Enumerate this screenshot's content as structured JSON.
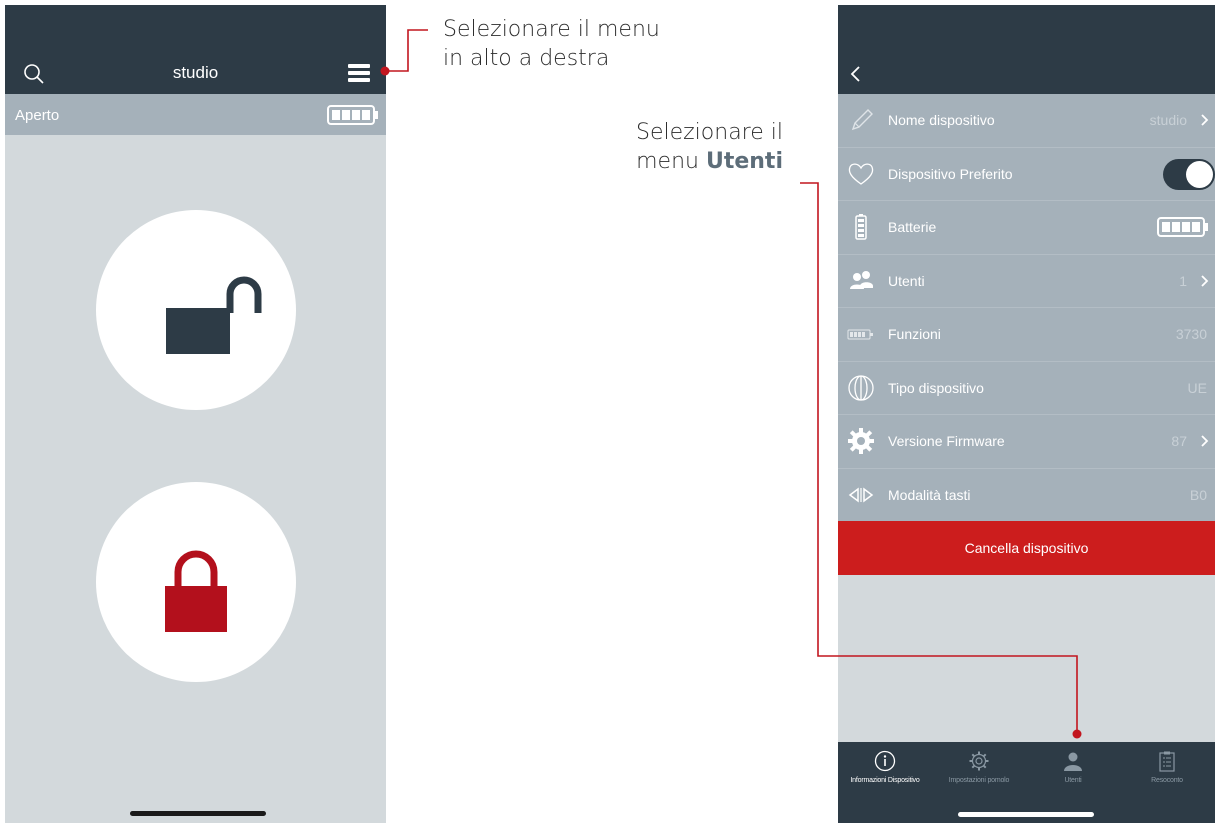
{
  "left_screen": {
    "title": "studio",
    "status_text": "Aperto",
    "icons": {
      "search": "search-icon",
      "menu": "hamburger-menu-icon",
      "battery": "battery-full-icon",
      "unlock": "padlock-open-icon",
      "lock": "padlock-closed-icon"
    },
    "colors": {
      "header": "#2d3b46",
      "status_bar": "#a5b1ba",
      "lock_red": "#b3101c"
    }
  },
  "annotations": {
    "menu_hint_line1": "Selezionare il menu",
    "menu_hint_line2": "in alto a destra",
    "users_hint_line1": "Selezionare il",
    "users_hint_prefix": "menu",
    "users_hint_bold": "Utenti"
  },
  "right_screen": {
    "rows": [
      {
        "label": "Nome dispositivo",
        "value": "studio",
        "icon": "pencil-icon"
      },
      {
        "label": "Dispositivo Preferito",
        "icon": "heart-icon",
        "toggle": "on"
      },
      {
        "label": "Batterie",
        "icon": "battery-vertical-icon"
      },
      {
        "label": "Utenti",
        "value": "1",
        "icon": "users-icon"
      },
      {
        "label": "Funzioni",
        "value": "3730",
        "icon": "counter-icon"
      },
      {
        "label": "Tipo dispositivo",
        "value": "UE",
        "icon": "knob-icon"
      },
      {
        "label": "Versione Firmware",
        "value": "87",
        "icon": "gear-icon"
      },
      {
        "label": "Modalità tasti",
        "value": "B0",
        "icon": "arrows-icon"
      }
    ],
    "delete_button": "Cancella dispositivo",
    "tabs": [
      {
        "label": "Informazioni Dispositivo",
        "icon": "info-icon"
      },
      {
        "label": "Impostazioni pomolo",
        "icon": "settings-icon"
      },
      {
        "label": "Utenti",
        "icon": "user-icon"
      },
      {
        "label": "Resoconto",
        "icon": "clipboard-icon"
      }
    ],
    "colors": {
      "header": "#2d3b46",
      "row": "#a5b1ba",
      "delete": "#cc1d1d"
    }
  },
  "connector_color": "#c2161f"
}
